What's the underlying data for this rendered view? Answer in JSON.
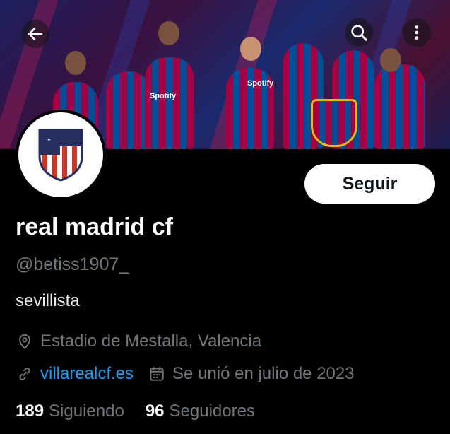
{
  "header": {
    "back_icon": "arrow-left-icon",
    "search_icon": "search-icon",
    "more_icon": "more-vertical-icon"
  },
  "banner": {
    "sponsor_text": "Spotify",
    "colors": {
      "blaugrana_red": "#a50044",
      "blaugrana_blue": "#004d98",
      "gold": "#edbb00"
    }
  },
  "profile": {
    "follow_label": "Seguir",
    "display_name": "real madrid cf",
    "handle": "@betiss1907_",
    "bio": "sevillista",
    "location": "Estadio de Mestalla, Valencia",
    "website": "villarealcf.es",
    "joined": "Se unió en julio de 2023",
    "following_count": "189",
    "following_label": "Siguiendo",
    "followers_count": "96",
    "followers_label": "Seguidores"
  },
  "colors": {
    "background": "#000000",
    "text_primary": "#e7e9ea",
    "text_secondary": "#71767b",
    "link": "#1d9bf0"
  }
}
